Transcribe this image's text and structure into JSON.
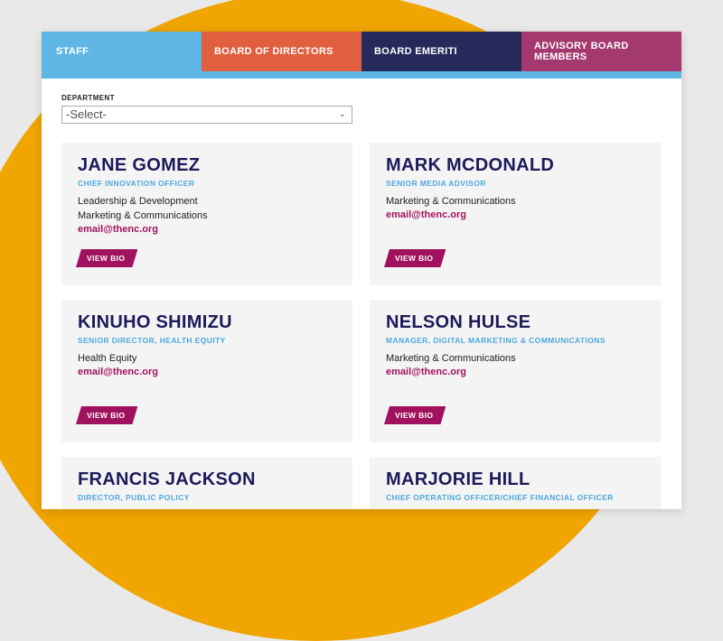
{
  "tabs": [
    {
      "label": "STAFF",
      "color": "#5fb6e4"
    },
    {
      "label": "BOARD OF DIRECTORS",
      "color": "#e05f3e"
    },
    {
      "label": "BOARD EMERITI",
      "color": "#252a5a"
    },
    {
      "label": "ADVISORY BOARD MEMBERS",
      "color": "#a3396e"
    }
  ],
  "filter": {
    "label": "DEPARTMENT",
    "selected": "-Select-"
  },
  "people": [
    {
      "name": "JANE GOMEZ",
      "title": "CHIEF INNOVATION OFFICER",
      "departments": [
        "Leadership & Development",
        "Marketing & Communications"
      ],
      "email": "email@thenc.org",
      "button": "VIEW BIO"
    },
    {
      "name": "MARK MCDONALD",
      "title": "SENIOR MEDIA ADVISOR",
      "departments": [
        "Marketing & Communications"
      ],
      "email": "email@thenc.org",
      "button": "VIEW BIO"
    },
    {
      "name": "KINUHO SHIMIZU",
      "title": "SENIOR DIRECTOR, HEALTH EQUITY",
      "departments": [
        "Health Equity"
      ],
      "email": "email@thenc.org",
      "button": "VIEW BIO"
    },
    {
      "name": "NELSON HULSE",
      "title": "MANAGER, DIGITAL MARKETING & COMMUNICATIONS",
      "departments": [
        "Marketing & Communications"
      ],
      "email": "email@thenc.org",
      "button": "VIEW BIO"
    },
    {
      "name": "FRANCIS JACKSON",
      "title": "DIRECTOR, PUBLIC POLICY",
      "departments": [],
      "email": "",
      "button": ""
    },
    {
      "name": "MARJORIE HILL",
      "title": "CHIEF OPERATING OFFICER/CHIEF FINANCIAL OFFICER",
      "departments": [],
      "email": "",
      "button": ""
    }
  ]
}
